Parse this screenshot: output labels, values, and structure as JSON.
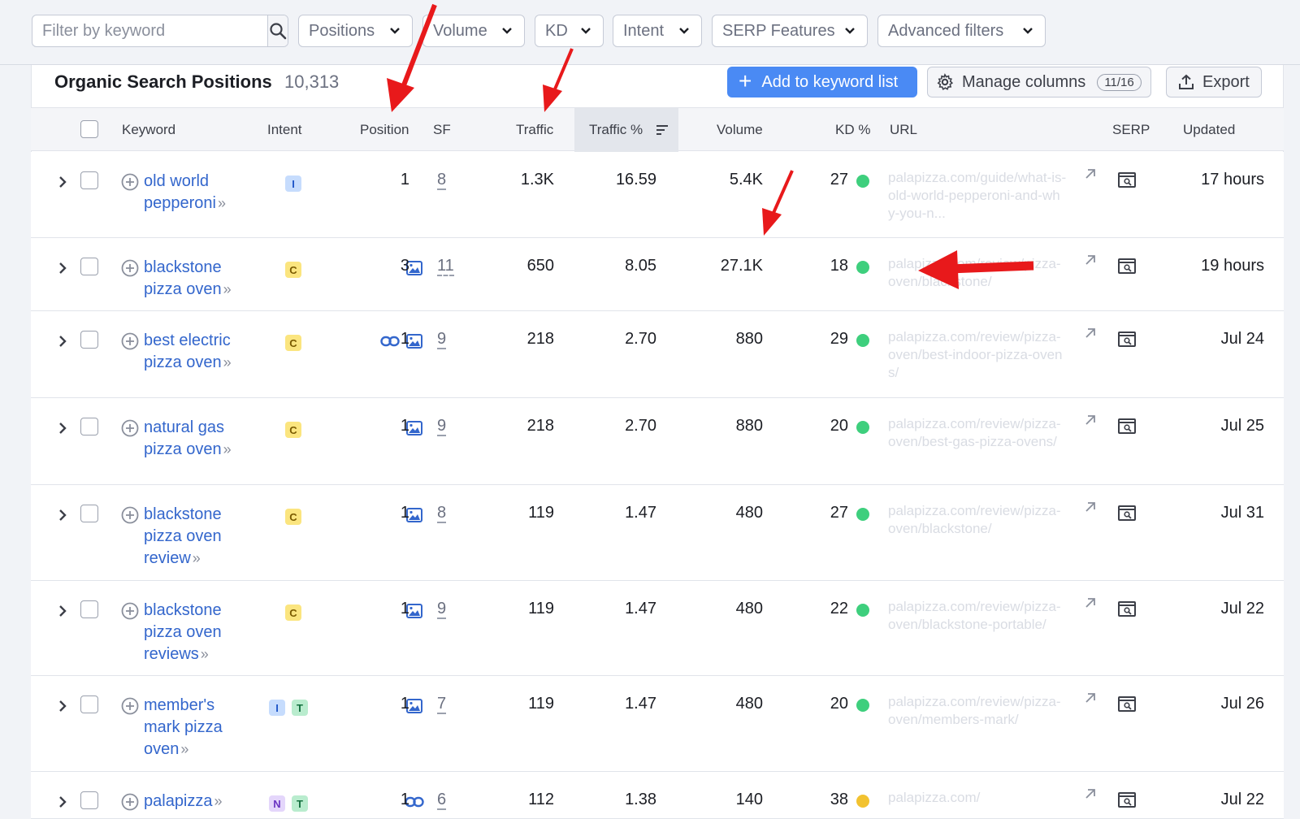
{
  "filters": {
    "search_placeholder": "Filter by keyword",
    "dropdowns": [
      "Positions",
      "Volume",
      "KD",
      "Intent",
      "SERP Features",
      "Advanced filters"
    ]
  },
  "panel": {
    "title": "Organic Search Positions",
    "count": "10,313",
    "add_button": "Add to keyword list",
    "manage_columns": "Manage columns",
    "columns_badge": "11/16",
    "export": "Export"
  },
  "columns": {
    "keyword": "Keyword",
    "intent": "Intent",
    "position": "Position",
    "sf": "SF",
    "traffic": "Traffic",
    "traffic_pct": "Traffic %",
    "volume": "Volume",
    "kd": "KD %",
    "url": "URL",
    "serp": "SERP",
    "updated": "Updated"
  },
  "rows": [
    {
      "kw1": "old world",
      "kw2": "pepperoni",
      "kw3": "",
      "intent": [
        "I"
      ],
      "pos": "1",
      "sf": "8",
      "traffic": "1.3K",
      "traffic_pct": "16.59",
      "volume": "5.4K",
      "kd": "27",
      "kd_color": "#3ecf7d",
      "url": "palapizza.com/guide/what-is-old-world-pepperoni-and-why-you-n...",
      "updated": "17 hours",
      "feat": []
    },
    {
      "kw1": "blackstone",
      "kw2": "pizza oven",
      "kw3": "",
      "intent": [
        "C"
      ],
      "pos": "3",
      "sf": "11",
      "traffic": "650",
      "traffic_pct": "8.05",
      "volume": "27.1K",
      "kd": "18",
      "kd_color": "#3ecf7d",
      "url": "palapizza.com/review/pizza-oven/blackstone/",
      "updated": "19 hours",
      "feat": [
        "image"
      ]
    },
    {
      "kw1": "best electric",
      "kw2": "pizza oven",
      "kw3": "",
      "intent": [
        "C"
      ],
      "pos": "1",
      "sf": "9",
      "traffic": "218",
      "traffic_pct": "2.70",
      "volume": "880",
      "kd": "29",
      "kd_color": "#3ecf7d",
      "url": "palapizza.com/review/pizza-oven/best-indoor-pizza-ovens/",
      "updated": "Jul 24",
      "feat": [
        "link",
        "image"
      ]
    },
    {
      "kw1": "natural gas",
      "kw2": "pizza oven",
      "kw3": "",
      "intent": [
        "C"
      ],
      "pos": "1",
      "sf": "9",
      "traffic": "218",
      "traffic_pct": "2.70",
      "volume": "880",
      "kd": "20",
      "kd_color": "#3ecf7d",
      "url": "palapizza.com/review/pizza-oven/best-gas-pizza-ovens/",
      "updated": "Jul 25",
      "feat": [
        "image"
      ]
    },
    {
      "kw1": "blackstone",
      "kw2": "pizza oven",
      "kw3": "review",
      "intent": [
        "C"
      ],
      "pos": "1",
      "sf": "8",
      "traffic": "119",
      "traffic_pct": "1.47",
      "volume": "480",
      "kd": "27",
      "kd_color": "#3ecf7d",
      "url": "palapizza.com/review/pizza-oven/blackstone/",
      "updated": "Jul 31",
      "feat": [
        "image"
      ]
    },
    {
      "kw1": "blackstone",
      "kw2": "pizza oven",
      "kw3": "reviews",
      "intent": [
        "C"
      ],
      "pos": "1",
      "sf": "9",
      "traffic": "119",
      "traffic_pct": "1.47",
      "volume": "480",
      "kd": "22",
      "kd_color": "#3ecf7d",
      "url": "palapizza.com/review/pizza-oven/blackstone-portable/",
      "updated": "Jul 22",
      "feat": [
        "image"
      ]
    },
    {
      "kw1": "member's",
      "kw2": "mark pizza",
      "kw3": "oven",
      "intent": [
        "I",
        "T"
      ],
      "pos": "1",
      "sf": "7",
      "traffic": "119",
      "traffic_pct": "1.47",
      "volume": "480",
      "kd": "20",
      "kd_color": "#3ecf7d",
      "url": "palapizza.com/review/pizza-oven/members-mark/",
      "updated": "Jul 26",
      "feat": [
        "image"
      ]
    },
    {
      "kw1": "palapizza",
      "kw2": "",
      "kw3": "",
      "intent": [
        "N",
        "T"
      ],
      "pos": "1",
      "sf": "6",
      "traffic": "112",
      "traffic_pct": "1.38",
      "volume": "140",
      "kd": "38",
      "kd_color": "#f2c230",
      "url": "palapizza.com/",
      "updated": "Jul 22",
      "feat": [
        "link"
      ]
    }
  ]
}
